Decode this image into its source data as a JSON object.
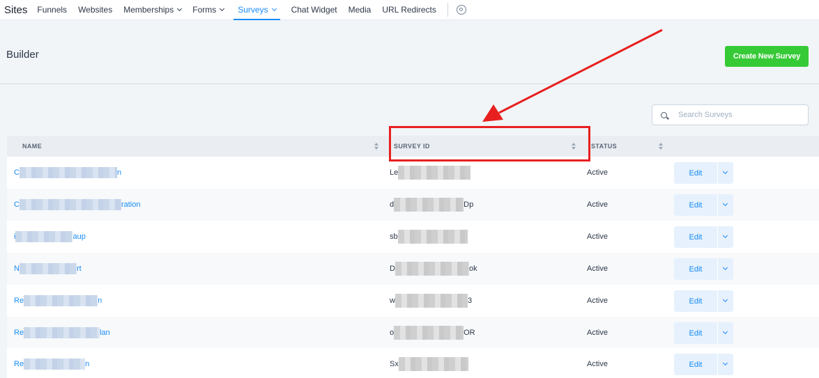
{
  "nav": {
    "app_title": "Sites",
    "items": [
      {
        "label": "Funnels",
        "dropdown": false
      },
      {
        "label": "Websites",
        "dropdown": false
      },
      {
        "label": "Memberships",
        "dropdown": true
      },
      {
        "label": "Forms",
        "dropdown": true
      },
      {
        "label": "Surveys",
        "dropdown": true,
        "active": true
      },
      {
        "label": "Chat Widget",
        "dropdown": false
      },
      {
        "label": "Media",
        "dropdown": false
      },
      {
        "label": "URL Redirects",
        "dropdown": false
      }
    ],
    "settings_icon": "gear-icon"
  },
  "header": {
    "title": "Builder",
    "create_button": "Create New Survey"
  },
  "search": {
    "placeholder": "Search Surveys"
  },
  "table": {
    "columns": [
      "NAME",
      "SURVEY ID",
      "STATUS"
    ],
    "rows": [
      {
        "name_start": "C",
        "name_end": "n",
        "id_start": "Le",
        "id_end": "",
        "status": "Active",
        "edit": "Edit"
      },
      {
        "name_start": "C",
        "name_end": "ration",
        "id_start": "d",
        "id_end": "Dp",
        "status": "Active",
        "edit": "Edit"
      },
      {
        "name_start": "i",
        "name_end": "aup",
        "id_start": "sb",
        "id_end": "",
        "status": "Active",
        "edit": "Edit"
      },
      {
        "name_start": "N",
        "name_end": "rt",
        "id_start": "D",
        "id_end": "ok",
        "status": "Active",
        "edit": "Edit"
      },
      {
        "name_start": "Re",
        "name_end": "n",
        "id_start": "w",
        "id_end": "3",
        "status": "Active",
        "edit": "Edit"
      },
      {
        "name_start": "Re",
        "name_end": "lan",
        "id_start": "o",
        "id_end": "OR",
        "status": "Active",
        "edit": "Edit"
      },
      {
        "name_start": "Re",
        "name_end": "n",
        "id_start": "Sx",
        "id_end": "",
        "status": "Active",
        "edit": "Edit"
      }
    ]
  },
  "annotation": {
    "color": "#e81f1f"
  },
  "colors": {
    "accent": "#188bf6",
    "create_button": "#37ca37",
    "highlight": "#e81f1f"
  }
}
